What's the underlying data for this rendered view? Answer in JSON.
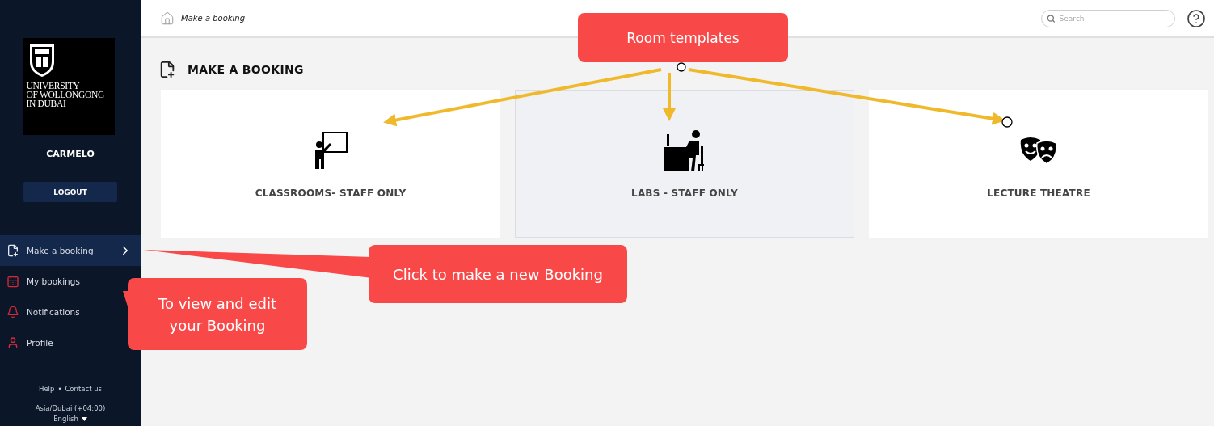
{
  "sidebar": {
    "logo": {
      "lines": [
        "UNIVERSITY",
        "OF WOLLONGONG",
        "IN DUBAI"
      ]
    },
    "user_name": "CARMELO",
    "logout": "LOGOUT",
    "nav": [
      {
        "label": "Make a booking",
        "kind": "booking",
        "selected": true
      },
      {
        "label": "My bookings",
        "kind": "calendar",
        "selected": false
      },
      {
        "label": "Notifications",
        "kind": "bell",
        "selected": false
      },
      {
        "label": "Profile",
        "kind": "person",
        "selected": false
      }
    ],
    "footer": {
      "links": [
        "Help",
        "Contact us"
      ],
      "separator": "•",
      "timezone": "Asia/Dubai (+04:00)",
      "language": "English"
    }
  },
  "header": {
    "breadcrumb": "Make a booking",
    "search": {
      "placeholder": "Search"
    }
  },
  "page": {
    "title": "MAKE A BOOKING",
    "templates": [
      {
        "label": "CLASSROOMS- STAFF ONLY",
        "kind": "classroom",
        "highlighted": false
      },
      {
        "label": "LABS - STAFF ONLY",
        "kind": "lab",
        "highlighted": true
      },
      {
        "label": "LECTURE THEATRE",
        "kind": "theatre",
        "highlighted": false
      }
    ]
  },
  "annotations": [
    {
      "kind": "templates",
      "text": "Room templates"
    },
    {
      "kind": "new-booking",
      "text": "Click to make a new Booking"
    },
    {
      "kind": "my-bookings",
      "text": "To view and edit your Booking"
    }
  ]
}
